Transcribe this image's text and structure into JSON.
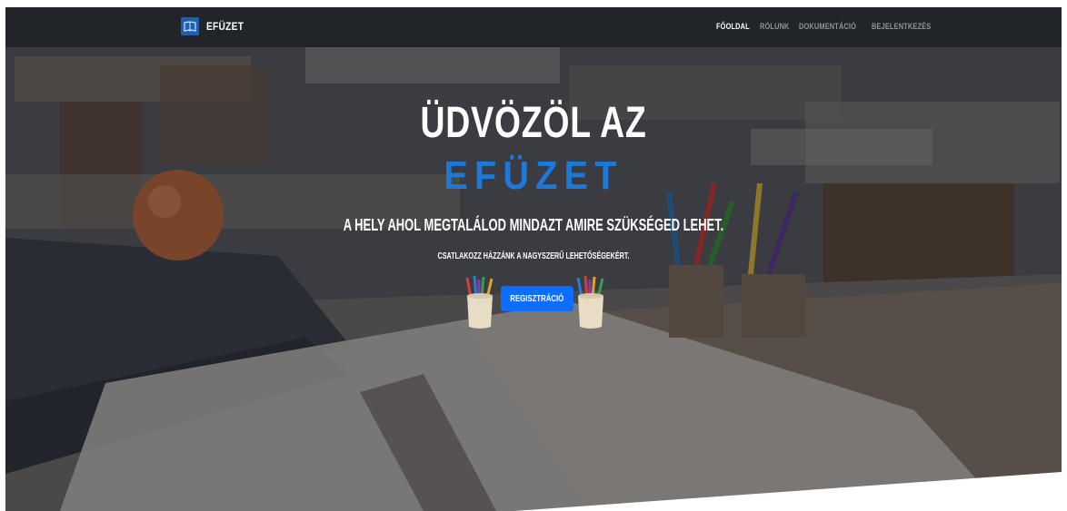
{
  "brand": {
    "name": "EFÜZET",
    "logo_icon": "book-icon"
  },
  "nav": {
    "items": [
      {
        "label": "FŐOLDAL",
        "active": true
      },
      {
        "label": "RÓLUNK",
        "active": false
      },
      {
        "label": "DOKUMENTÁCIÓ",
        "active": false
      },
      {
        "label": "BEJELENTKEZÉS",
        "active": false
      }
    ]
  },
  "hero": {
    "title_line1": "ÜDVÖZÖL AZ",
    "title_line2": "EFÜZET",
    "subtitle": "A HELY AHOL MEGTALÁLOD MINDAZT AMIRE SZÜKSÉGED LEHET.",
    "tagline": "CSATLAKOZZ HÁZZÁNK A NAGYSZERŰ LEHETŐSÉGEKÉRT.",
    "cta_label": "REGISZTRÁCIÓ",
    "decor_icon": "pencil-cup-icon"
  },
  "colors": {
    "navbar_bg": "#212529",
    "accent": "#1e78d6",
    "button_bg": "#0d6efd",
    "nav_inactive": "#8e959c"
  }
}
